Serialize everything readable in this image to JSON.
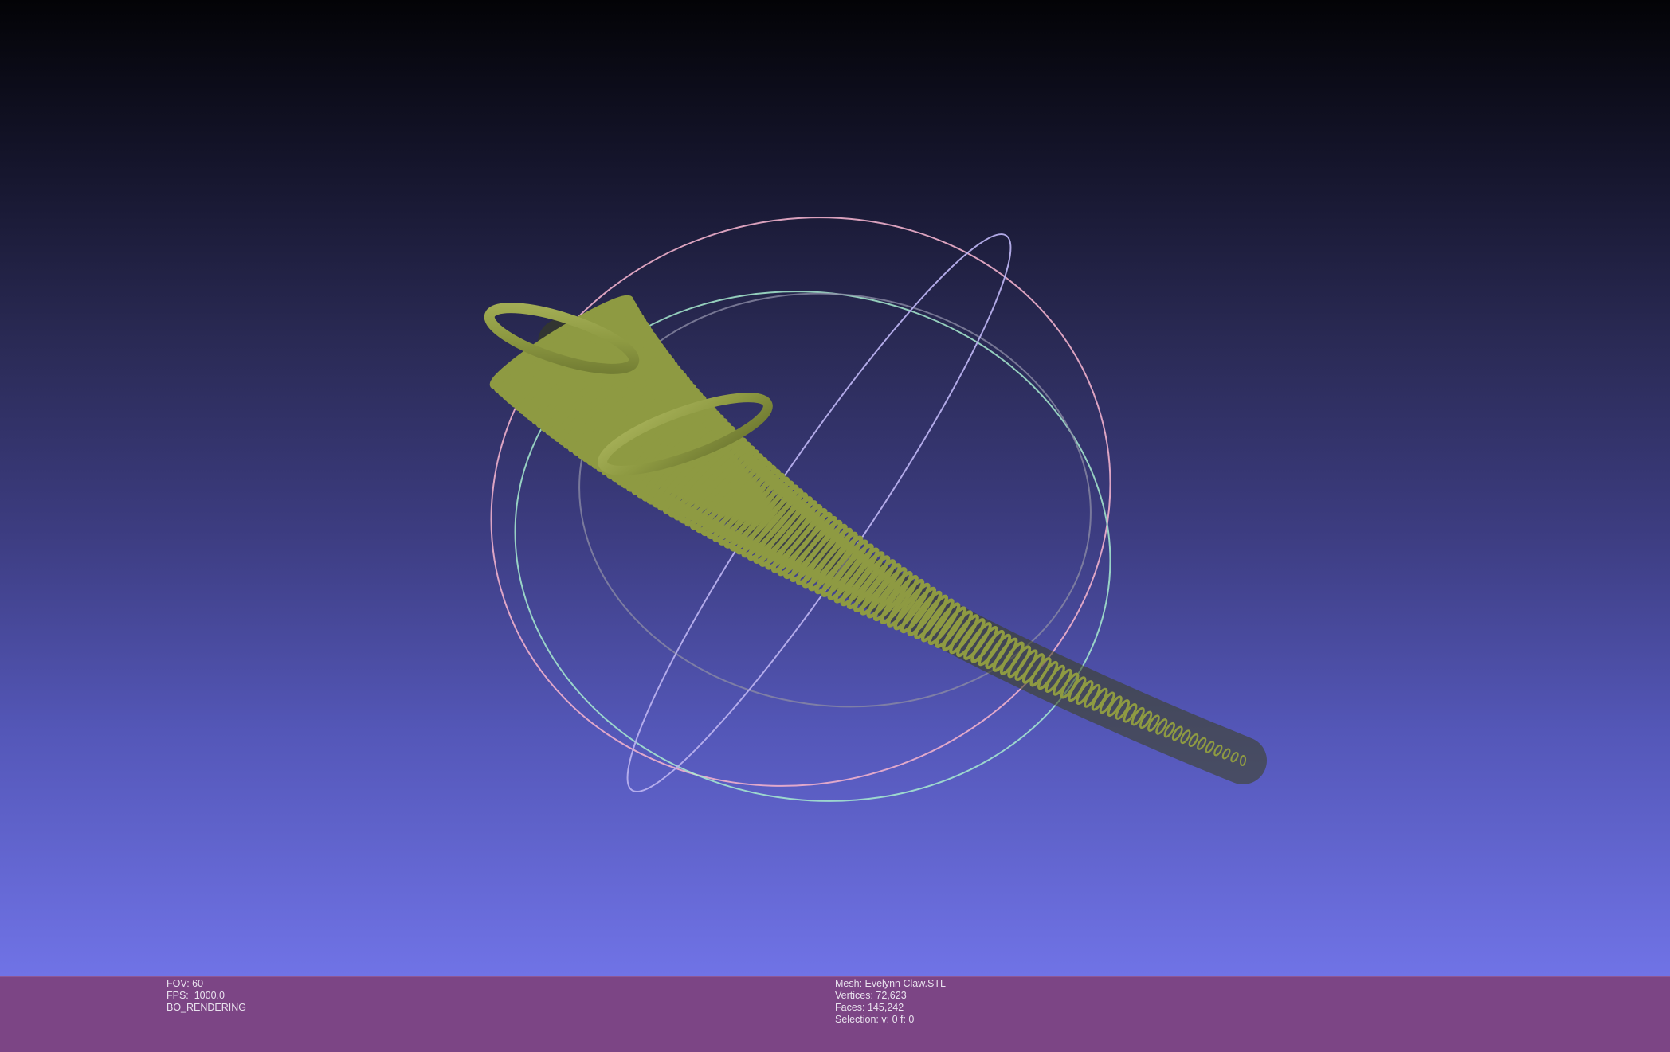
{
  "viewer": {
    "background": {
      "top": "#030306",
      "bottom": "#7073e6"
    },
    "mesh_color": "#8e9a42",
    "trackball": {
      "x_ring_color": "#f0b0cc",
      "y_ring_color": "#b8b0ee",
      "z_ring_color": "#a8ecd0",
      "inner_ring_color": "#8a8aa4"
    }
  },
  "info": {
    "fov": "FOV: 60",
    "fps": "FPS:  1000.0",
    "rendering_mode": "BO_RENDERING",
    "mesh_name": "Mesh: Evelynn Claw.STL",
    "vertices": "Vertices: 72,623",
    "faces": "Faces: 145,242",
    "selection": "Selection: v: 0 f: 0"
  },
  "info_bar_color": "#7c4585"
}
